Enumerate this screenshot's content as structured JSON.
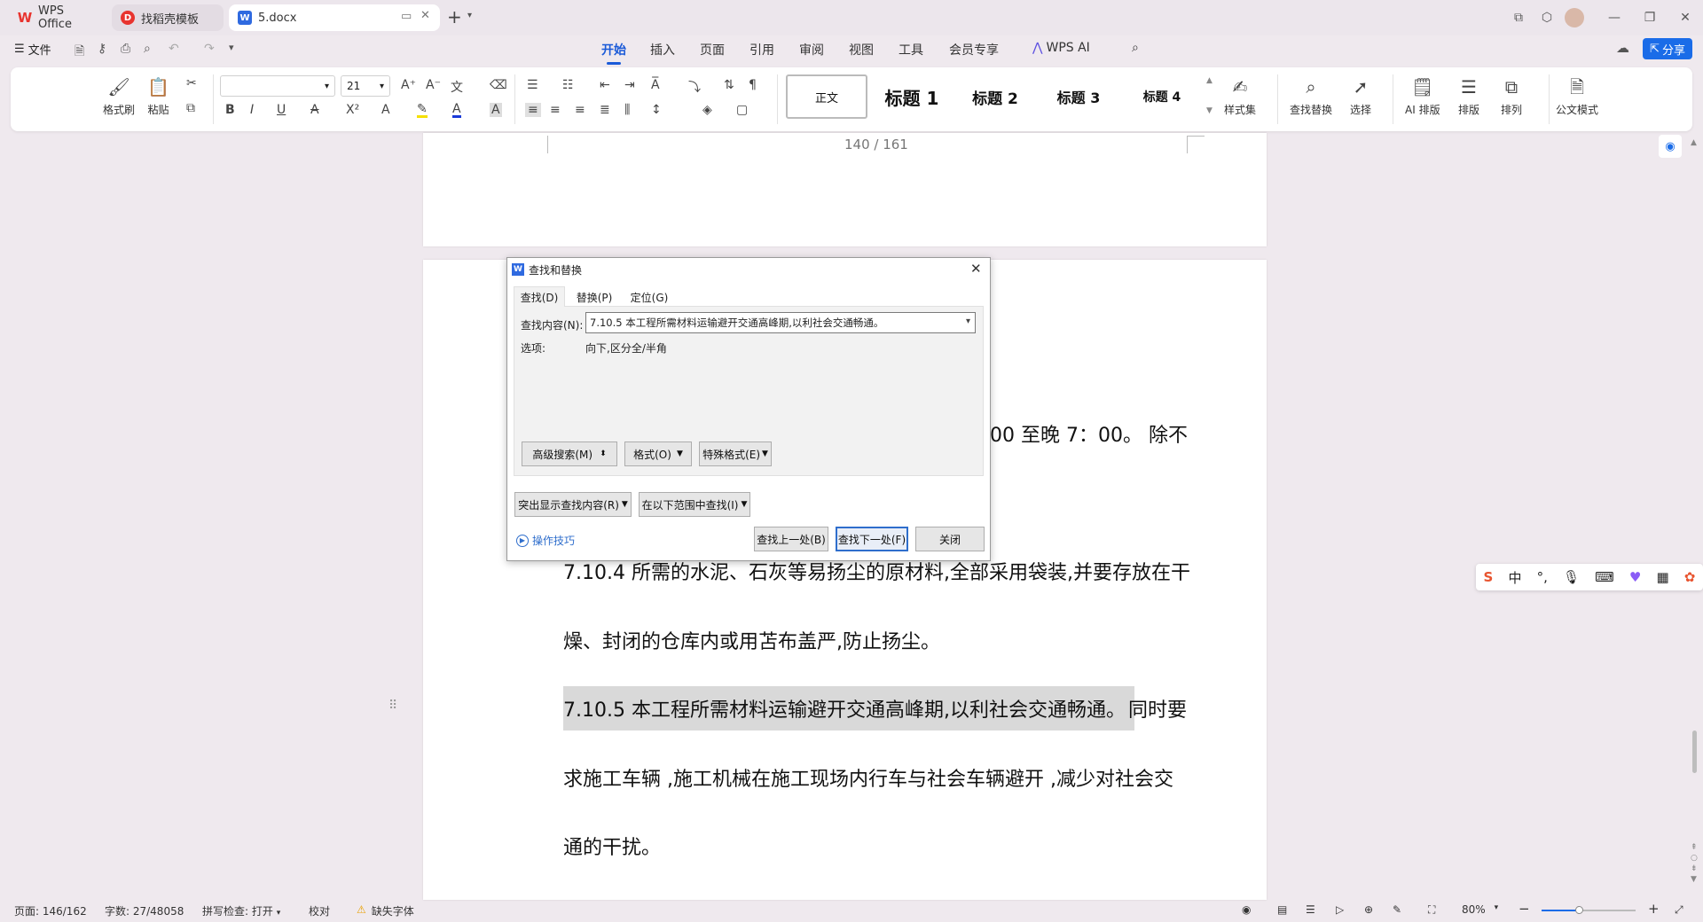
{
  "tabs": [
    {
      "label": "WPS Office",
      "icon": "wps-logo-icon"
    },
    {
      "label": "找稻壳模板",
      "icon": "docer-icon"
    },
    {
      "label": "5.docx",
      "icon": "word-doc-icon"
    }
  ],
  "menu": {
    "file": "文件",
    "items": [
      "开始",
      "插入",
      "页面",
      "引用",
      "审阅",
      "视图",
      "工具",
      "会员专享",
      "WPS AI"
    ],
    "active": "开始",
    "share": "分享"
  },
  "ribbon": {
    "format_painter": "格式刷",
    "paste": "粘贴",
    "font_name": "",
    "font_size": "21",
    "styles": [
      "正文",
      "标题 1",
      "标题 2",
      "标题 3",
      "标题 4"
    ],
    "style_set": "样式集",
    "find_replace": "查找替换",
    "select": "选择",
    "ai_layout": "AI 排版",
    "layout": "排版",
    "arrange": "排列",
    "official_mode": "公文模式"
  },
  "document": {
    "page_indicator": "140 /  161",
    "partial_line": "00 至晚 7：00。   除不",
    "p1_line1": "7.10.4 所需的水泥、石灰等易扬尘的原材料,全部采用袋装,并要存放在干",
    "p1_line2": "燥、封闭的仓库内或用苫布盖严,防止扬尘。",
    "p2_highlight": "7.10.5 本工程所需材料运输避开交通高峰期,以利社会交通畅通。",
    "p2_rest": "同时要",
    "p2_line2": "求施工车辆 ,施工机械在施工现场内行车与社会车辆避开 ,减少对社会交",
    "p2_line3": "通的干扰。"
  },
  "dialog": {
    "title": "查找和替换",
    "tabs": [
      "查找(D)",
      "替换(P)",
      "定位(G)"
    ],
    "find_label": "查找内容(N):",
    "find_value": "7.10.5 本工程所需材料运输避开交通高峰期,以利社会交通畅通。",
    "options_label": "选项:",
    "options_value": "向下,区分全/半角",
    "advanced_search": "高级搜索(M)",
    "format": "格式(O)",
    "special_format": "特殊格式(E)",
    "highlight_find": "突出显示查找内容(R)",
    "find_in_range": "在以下范围中查找(I)",
    "tips": "操作技巧",
    "find_prev": "查找上一处(B)",
    "find_next": "查找下一处(F)",
    "close": "关闭"
  },
  "ime": {
    "lang": "中"
  },
  "status": {
    "page": "页面: 146/162",
    "words": "字数: 27/48058",
    "spell": "拼写检查: 打开",
    "proof": "校对",
    "missing_font": "缺失字体",
    "zoom": "80%"
  },
  "colors": {
    "accent": "#1a5ad8",
    "share": "#1a6ce8",
    "wps_red": "#e8342f",
    "highlight": "#d9d9d9"
  }
}
